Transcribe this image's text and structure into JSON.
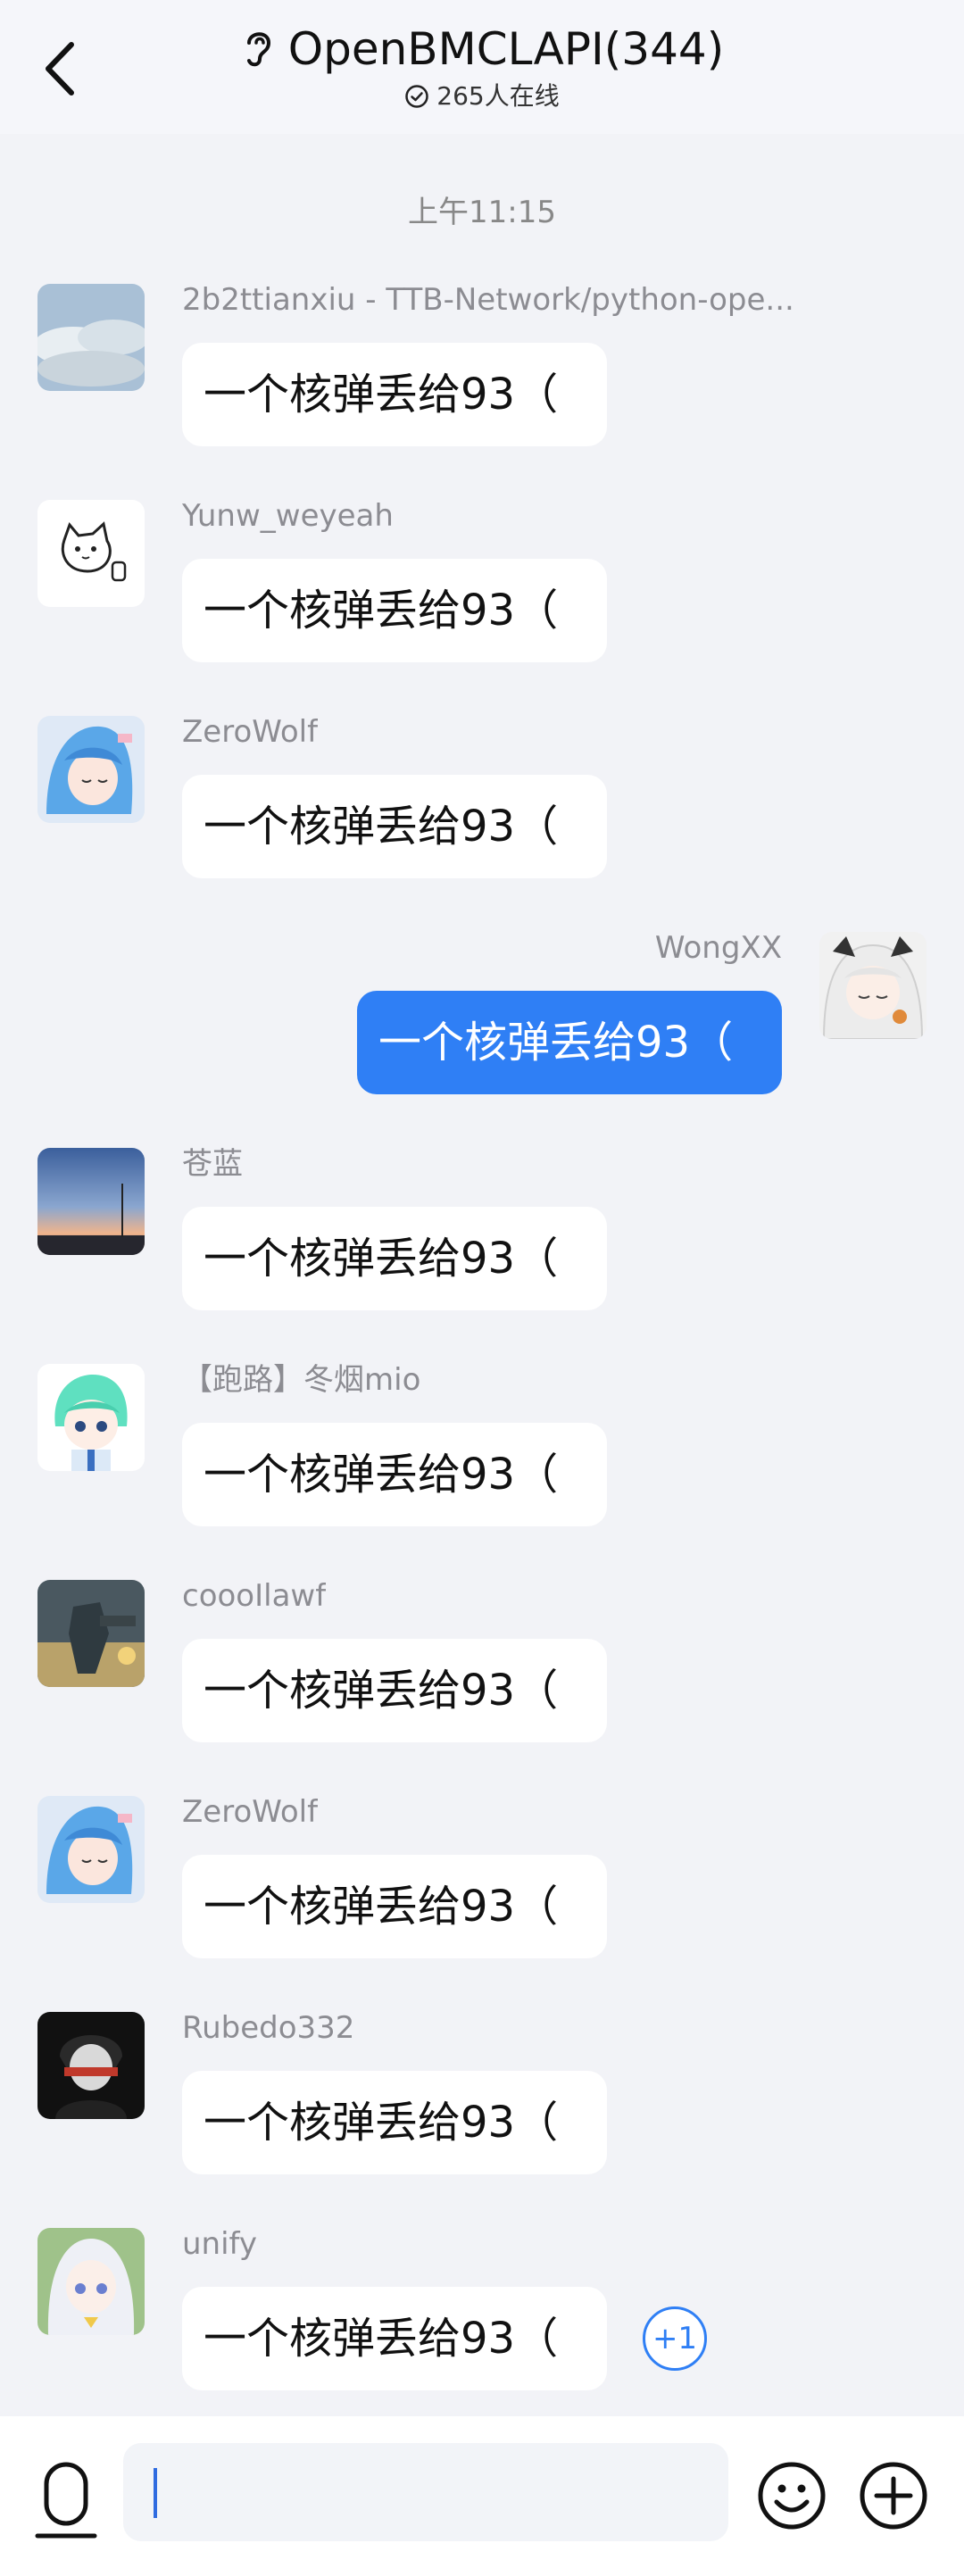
{
  "header": {
    "title": "OpenBMCLAPI(344)",
    "online": "265人在线"
  },
  "time_divider": "上午11:15",
  "messages": [
    {
      "name": "2b2ttianxiu - TTB-Network/python-ope...",
      "text": "一个核弹丢给93（",
      "avatar": "sky-clouds"
    },
    {
      "name": "Yunw_weyeah",
      "text": "一个核弹丢给93（",
      "avatar": "cat-sketch"
    },
    {
      "name": "ZeroWolf",
      "text": "一个核弹丢给93（",
      "avatar": "blue-hair-girl"
    },
    {
      "name": "WongXX",
      "text": "一个核弹丢给93（",
      "avatar": "white-hair-girl",
      "self": true
    },
    {
      "name": "苍蓝",
      "text": "一个核弹丢给93（",
      "avatar": "sunset-sky"
    },
    {
      "name": "【跑路】冬烟mio",
      "text": "一个核弹丢给93（",
      "avatar": "green-hair-chibi"
    },
    {
      "name": "coooIlawf",
      "text": "一个核弹丢给93（",
      "avatar": "mech-robot"
    },
    {
      "name": "ZeroWolf",
      "text": "一个核弹丢给93（",
      "avatar": "blue-hair-girl"
    },
    {
      "name": "Rubedo332",
      "text": "一个核弹丢给93（",
      "avatar": "dark-anime-boy"
    },
    {
      "name": "unify",
      "text": "一个核弹丢给93（",
      "avatar": "white-hair-anime"
    }
  ],
  "plus_one": "+1",
  "colors": {
    "accent": "#2f7ff5",
    "background": "#f2f3f7"
  },
  "icons": {
    "back": "chevron-left-icon",
    "group": "ear-icon",
    "online": "check-circle-icon",
    "voice": "microphone-icon",
    "emoji": "smiley-icon",
    "more": "plus-circle-icon"
  }
}
